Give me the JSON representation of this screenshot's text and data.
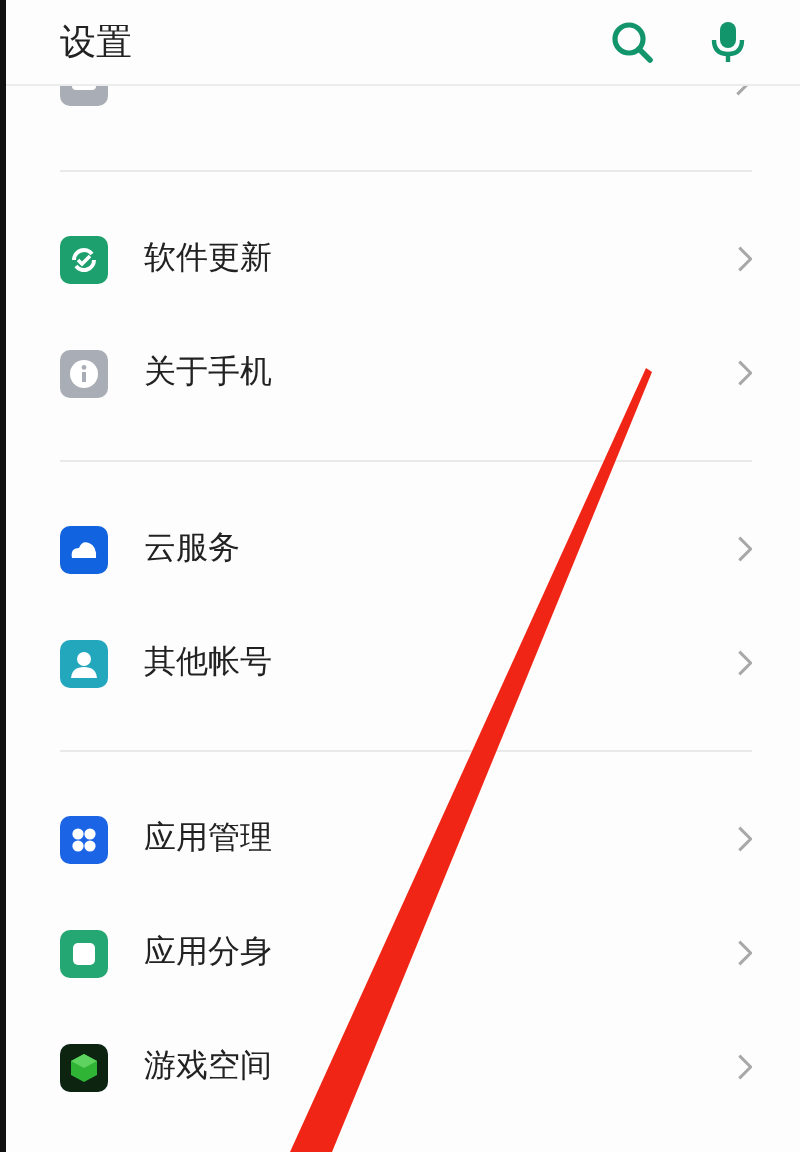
{
  "header": {
    "title": "设置"
  },
  "groups": [
    {
      "items": [
        {
          "kind": "more",
          "cut_off": true
        }
      ]
    },
    {
      "items": [
        {
          "label": "软件更新",
          "kind": "update"
        },
        {
          "label": "关于手机",
          "kind": "info"
        }
      ]
    },
    {
      "items": [
        {
          "label": "云服务",
          "kind": "cloud"
        },
        {
          "label": "其他帐号",
          "kind": "account"
        }
      ]
    },
    {
      "items": [
        {
          "label": "应用管理",
          "kind": "apps"
        },
        {
          "label": "应用分身",
          "kind": "clone"
        },
        {
          "label": "游戏空间",
          "kind": "game"
        }
      ]
    }
  ]
}
